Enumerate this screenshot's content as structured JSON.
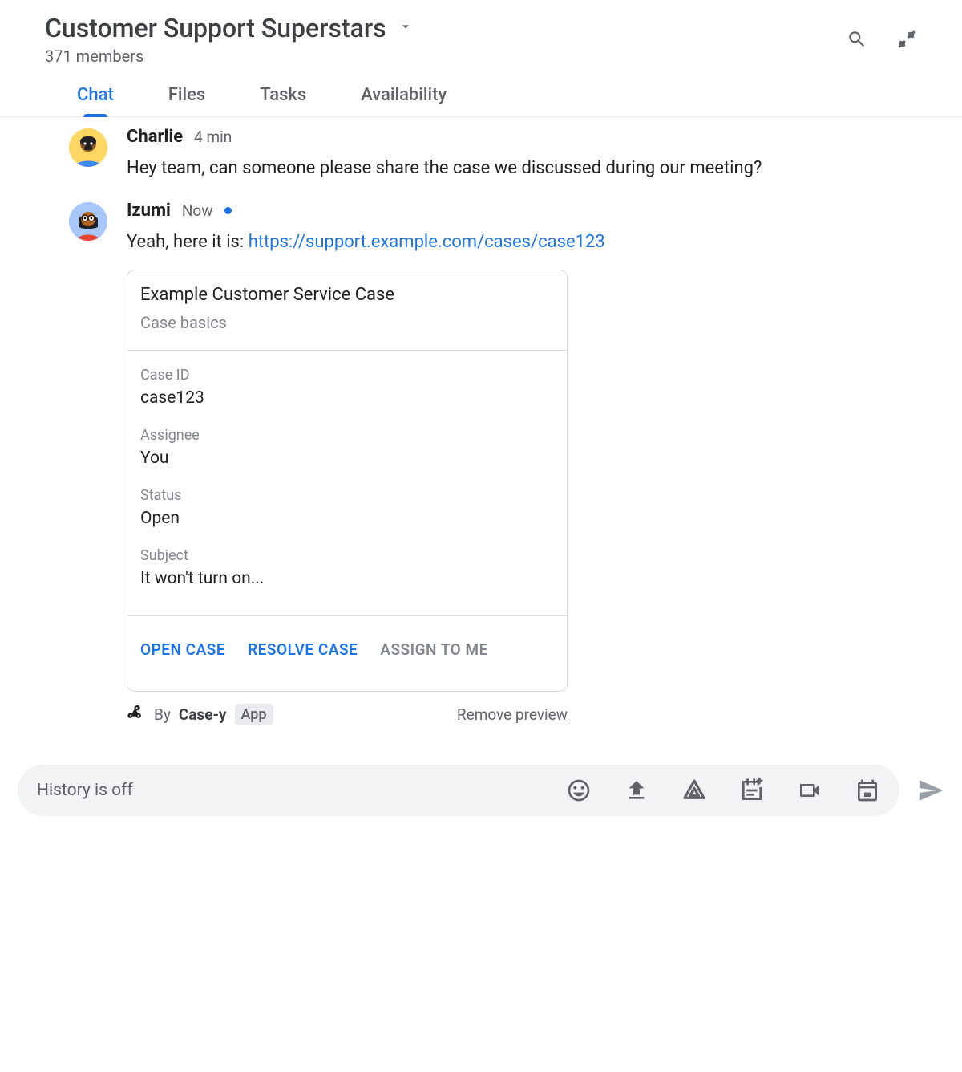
{
  "header": {
    "title": "Customer Support Superstars",
    "members": "371 members"
  },
  "tabs": [
    {
      "label": "Chat",
      "active": true
    },
    {
      "label": "Files",
      "active": false
    },
    {
      "label": "Tasks",
      "active": false
    },
    {
      "label": "Availability",
      "active": false
    }
  ],
  "messages": {
    "m1": {
      "sender": "Charlie",
      "time": "4 min",
      "text": "Hey team, can someone please share the case we discussed during our meeting?"
    },
    "m2": {
      "sender": "Izumi",
      "time": "Now",
      "text_prefix": "Yeah, here it is: ",
      "link": "https://support.example.com/cases/case123"
    }
  },
  "card": {
    "title": "Example Customer Service Case",
    "subtitle": "Case basics",
    "fields": {
      "case_id": {
        "label": "Case ID",
        "value": "case123"
      },
      "assignee": {
        "label": "Assignee",
        "value": "You"
      },
      "status": {
        "label": "Status",
        "value": "Open"
      },
      "subject": {
        "label": "Subject",
        "value": "It won't turn on..."
      }
    },
    "actions": {
      "open": "OPEN CASE",
      "resolve": "RESOLVE CASE",
      "assign": "ASSIGN TO ME"
    },
    "by_prefix": "By",
    "by_name": "Case-y",
    "badge": "App",
    "remove": "Remove preview"
  },
  "composer": {
    "placeholder": "History is off"
  }
}
